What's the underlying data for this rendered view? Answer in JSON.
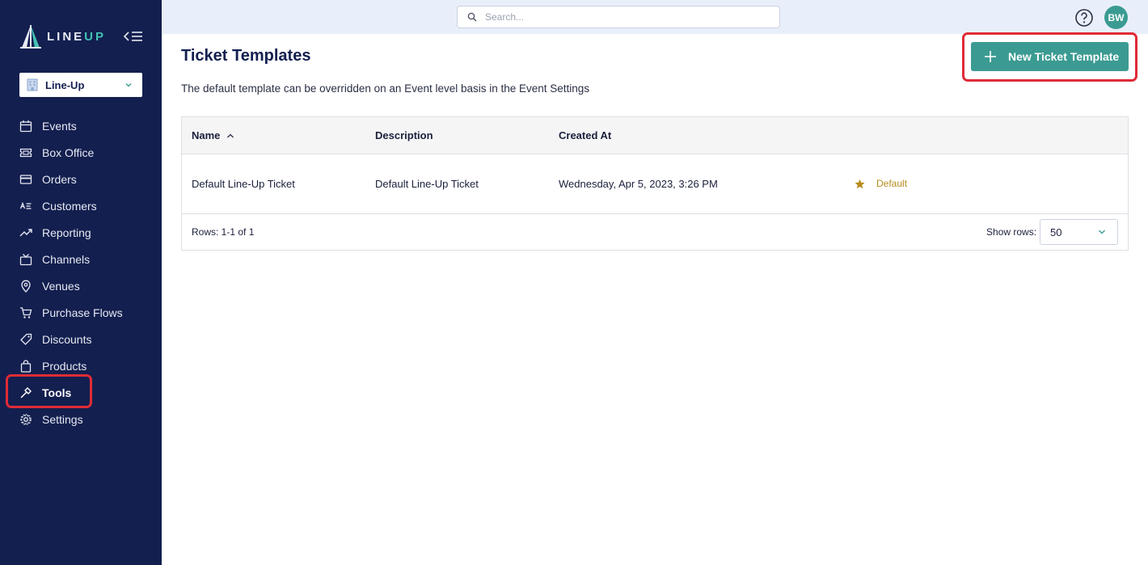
{
  "brand": {
    "name_part1": "LINE",
    "name_part2": "UP",
    "accent_color": "#44c2b5",
    "sidebar_color": "#131f4f",
    "primary_button_color": "#3b9b92"
  },
  "org_selector": {
    "value": "Line-Up"
  },
  "nav": {
    "items": [
      {
        "label": "Events",
        "icon": "calendar-icon"
      },
      {
        "label": "Box Office",
        "icon": "ticket-icon"
      },
      {
        "label": "Orders",
        "icon": "card-icon"
      },
      {
        "label": "Customers",
        "icon": "contacts-icon"
      },
      {
        "label": "Reporting",
        "icon": "trend-icon"
      },
      {
        "label": "Channels",
        "icon": "tv-icon"
      },
      {
        "label": "Venues",
        "icon": "location-pin-icon"
      },
      {
        "label": "Purchase Flows",
        "icon": "cart-icon"
      },
      {
        "label": "Discounts",
        "icon": "tag-icon"
      },
      {
        "label": "Products",
        "icon": "bag-icon"
      },
      {
        "label": "Tools",
        "icon": "hammer-icon",
        "active": true
      },
      {
        "label": "Settings",
        "icon": "gear-icon"
      }
    ]
  },
  "topbar": {
    "search_placeholder": "Search...",
    "avatar_initials": "BW"
  },
  "page": {
    "title": "Ticket Templates",
    "description": "The default template can be overridden on an Event level basis in the Event Settings",
    "new_button_label": "New Ticket Template"
  },
  "table": {
    "columns": [
      "Name",
      "Description",
      "Created At"
    ],
    "rows": [
      {
        "name": "Default Line-Up Ticket",
        "description": "Default Line-Up Ticket",
        "created_at": "Wednesday, Apr 5, 2023, 3:26 PM",
        "badge": "Default"
      }
    ],
    "rows_count": "Rows: 1-1 of 1",
    "show_rows_label": "Show rows:",
    "show_rows_value": "50"
  }
}
